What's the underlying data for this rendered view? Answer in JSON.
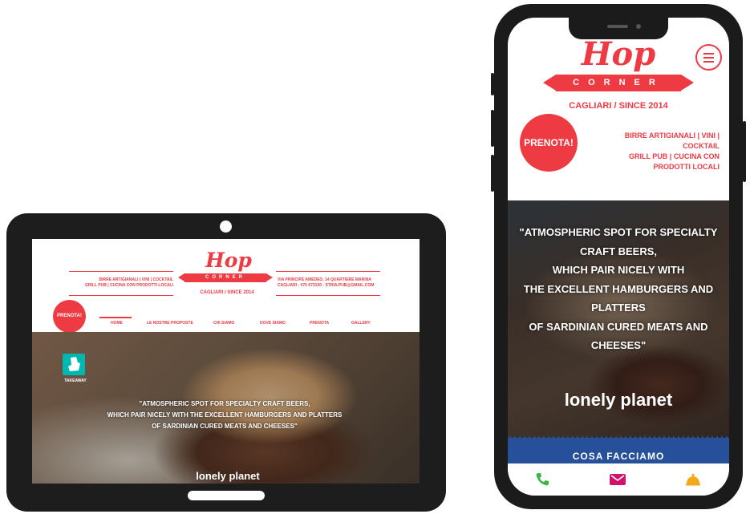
{
  "brand": {
    "logo_script": "Hop",
    "logo_ribbon": "CORNER",
    "city": "CAGLIARI / SINCE 2014",
    "accent_color": "#ee3a43",
    "blue_color": "#27509a"
  },
  "tablet": {
    "header_left": [
      "BIRRE ARTIGIANALI | VINI | COCKTAIL",
      "GRILL PUB | CUCINA CON PRODOTTI LOCALI"
    ],
    "header_right": [
      "VIA PRINCIPE AMEDEO, 14 QUARTIERE MARINA",
      "CAGLIARI - 070 673150 - STRIA.PUB@GMAIL.COM"
    ],
    "badge": "PRENOTA!",
    "nav": [
      "HOME",
      "LE NOSTRE PROPOSTE",
      "CHI SIAMO",
      "DOVE SIAMO",
      "PRENOTA",
      "GALLERY"
    ],
    "delivery_label": "TAKEAWAY",
    "quote": [
      "\"ATMOSPHERIC SPOT FOR SPECIALTY CRAFT BEERS,",
      "WHICH PAIR NICELY WITH THE EXCELLENT HAMBURGERS AND PLATTERS",
      "OF SARDINIAN CURED MEATS AND CHEESES\""
    ],
    "quote_logo": "lonely planet"
  },
  "phone": {
    "badge": "PRENOTA!",
    "tagline": [
      "BIRRE ARTIGIANALI | VINI |",
      "COCKTAIL",
      "GRILL PUB | CUCINA CON",
      "PRODOTTI LOCALI"
    ],
    "quote": [
      "\"ATMOSPHERIC SPOT FOR SPECIALTY",
      "CRAFT BEERS,",
      "WHICH PAIR NICELY WITH",
      "THE EXCELLENT HAMBURGERS AND",
      "PLATTERS",
      "OF SARDINIAN CURED MEATS AND",
      "CHEESES\""
    ],
    "quote_logo": "lonely planet",
    "section_title": "COSA FACCIAMO",
    "bottom_icons": [
      "phone-icon",
      "mail-icon",
      "bell-icon"
    ]
  }
}
